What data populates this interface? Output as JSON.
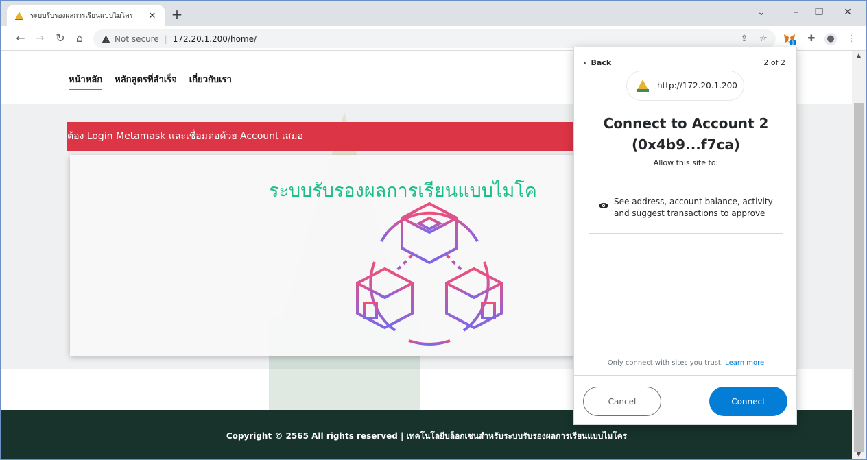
{
  "browser": {
    "tab_title": "ระบบรับรองผลการเรียนแบบไมโคร",
    "new_tab_label": "+",
    "security_label": "Not secure",
    "separator": "|",
    "url": "172.20.1.200/home/",
    "extension_badge": "1"
  },
  "site": {
    "nav": [
      {
        "label": "หน้าหลัก"
      },
      {
        "label": "หลักสูตรที่สำเร็จ"
      },
      {
        "label": "เกี่ยวกับเรา"
      }
    ],
    "alert": "ต้อง Login Metamask และเชื่อมต่อด้วย Account เสมอ",
    "card_title": "ระบบรับรองผลการเรียนแบบไมโค",
    "footer": "Copyright © 2565 All rights reserved | เทคโนโลยีบล็อกเชนสำหรับระบบรับรองผลการเรียนแบบไมโคร"
  },
  "metamask": {
    "back_label": "Back",
    "step": "2 of 2",
    "site_url": "http://172.20.1.200",
    "title_line1": "Connect to Account 2",
    "title_line2": "(0x4b9...f7ca)",
    "allow": "Allow this site to:",
    "permission": "See address, account balance, activity and suggest transactions to approve",
    "trust_note": "Only connect with sites you trust.",
    "learn_more": "Learn more",
    "cancel_label": "Cancel",
    "connect_label": "Connect",
    "connect_color": "#037dd6"
  },
  "colors": {
    "alert": "#dc3545",
    "title_green": "#1cbf8b",
    "footer": "#17332c"
  }
}
